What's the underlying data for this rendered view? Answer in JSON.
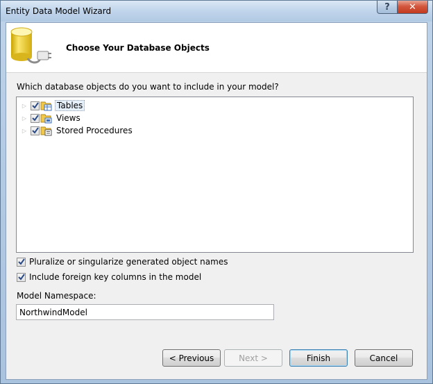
{
  "window": {
    "title": "Entity Data Model Wizard"
  },
  "titlebar_buttons": {
    "help": "?",
    "close": "✕"
  },
  "header": {
    "title": "Choose Your Database Objects",
    "icon": "database-connection-icon"
  },
  "prompt": "Which database objects do you want to include in your model?",
  "tree": {
    "items": [
      {
        "label": "Tables",
        "checked": true,
        "icon": "tables-icon",
        "selected": true
      },
      {
        "label": "Views",
        "checked": true,
        "icon": "views-icon",
        "selected": false
      },
      {
        "label": "Stored Procedures",
        "checked": true,
        "icon": "stored-procedures-icon",
        "selected": false
      }
    ]
  },
  "options": {
    "pluralize": {
      "label": "Pluralize or singularize generated object names",
      "checked": true
    },
    "foreign_keys": {
      "label": "Include foreign key columns in the model",
      "checked": true
    }
  },
  "namespace": {
    "label": "Model Namespace:",
    "value": "NorthwindModel"
  },
  "buttons": {
    "previous": "< Previous",
    "next": "Next >",
    "finish": "Finish",
    "cancel": "Cancel"
  },
  "colors": {
    "title_bar": "#c2d6ec",
    "close_button": "#c23a1f",
    "selection": "#e6f0fa"
  }
}
